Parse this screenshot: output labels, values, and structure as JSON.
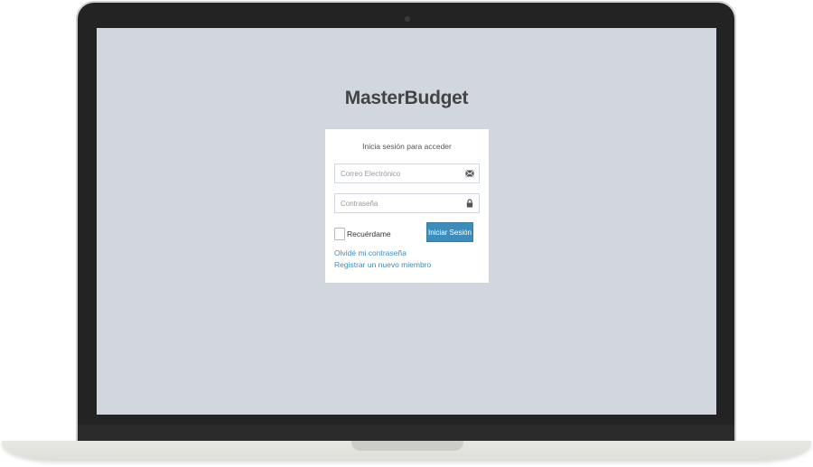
{
  "app": {
    "title": "MasterBudget"
  },
  "login": {
    "message": "Inicia sesión para acceder",
    "email_placeholder": "Correo Electrónico",
    "password_placeholder": "Contraseña",
    "remember_label": "Recuérdame",
    "remember_checked": false,
    "signin_label": "Iniciar Sesión",
    "forgot_link": "Olvidé mi contraseña",
    "register_link": "Registrar un nuevo miembro"
  },
  "icons": {
    "email": "envelope-icon",
    "password": "lock-icon"
  },
  "colors": {
    "background": "#d2d6de",
    "primary": "#3c8dbc",
    "link": "#3c8dbc"
  }
}
